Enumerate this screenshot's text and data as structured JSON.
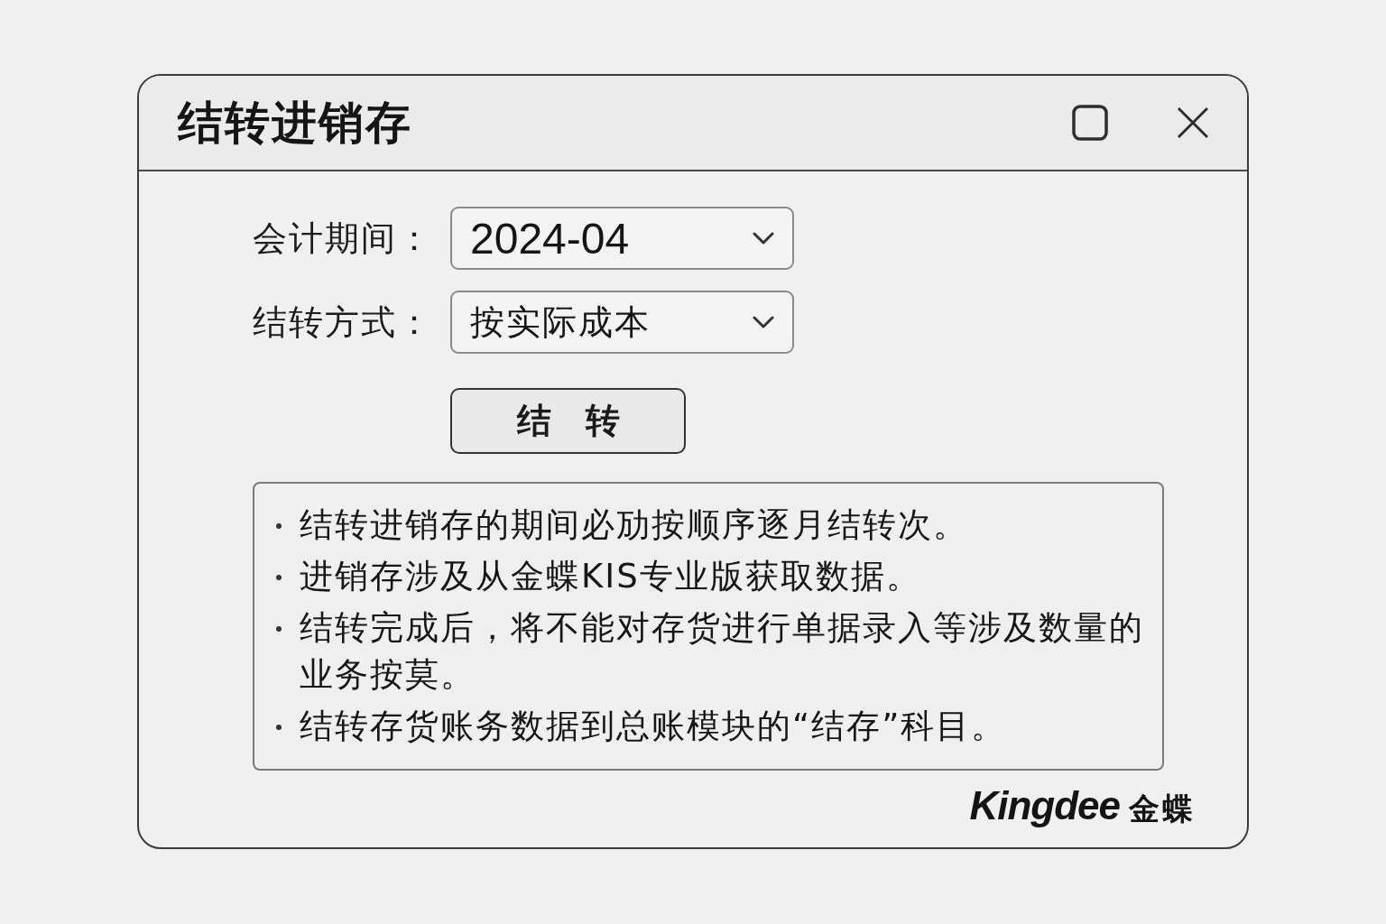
{
  "window": {
    "title": "结转进销存"
  },
  "form": {
    "fields": [
      {
        "label": "会计期间：",
        "value": "2024-04",
        "kind": "date"
      },
      {
        "label": "结转方式：",
        "value": "按实际成本",
        "kind": "choice"
      }
    ],
    "button": {
      "label": "结　转"
    }
  },
  "notes": [
    "结转进销存的期间必劢按顺序逐月结转次。",
    "进销存涉及从金蝶KIS专业版获取数据。",
    "结转完成后，将不能对存货进行单据录入等涉及数量的业务按莫。",
    "结转存货账务数据到总账模块的“结存”科目。"
  ],
  "brand": {
    "wordmark": "Kingdee",
    "name": "金蝶"
  }
}
